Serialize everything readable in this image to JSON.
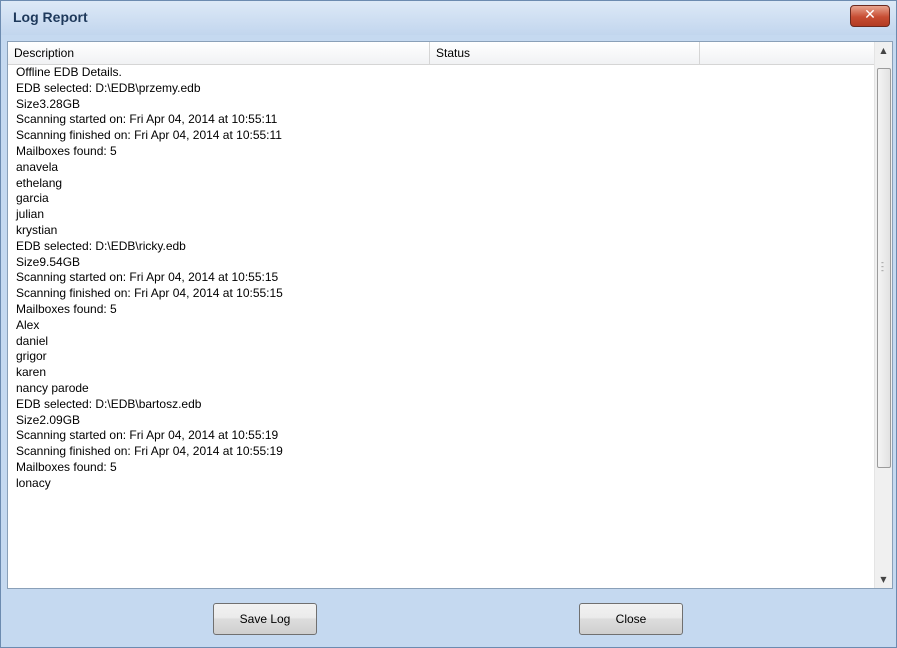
{
  "window": {
    "title": "Log Report",
    "close_glyph": "✕"
  },
  "table": {
    "columns": [
      "Description",
      "Status",
      ""
    ],
    "rows": [
      "Offline EDB Details.",
      "EDB selected: D:\\EDB\\przemy.edb",
      "Size3.28GB",
      "Scanning started on: Fri Apr 04, 2014 at  10:55:11",
      "Scanning finished on: Fri Apr 04, 2014 at  10:55:11",
      "Mailboxes found: 5",
      "anavela",
      "ethelang",
      "garcia",
      "julian",
      "krystian",
      "EDB selected: D:\\EDB\\ricky.edb",
      "Size9.54GB",
      "Scanning started on: Fri Apr 04, 2014 at  10:55:15",
      "Scanning finished on: Fri Apr 04, 2014 at  10:55:15",
      "Mailboxes found: 5",
      "Alex",
      "daniel",
      "grigor",
      "karen",
      "nancy parode",
      "EDB selected: D:\\EDB\\bartosz.edb",
      "Size2.09GB",
      "Scanning started on: Fri Apr 04, 2014 at  10:55:19",
      "Scanning finished on: Fri Apr 04, 2014 at  10:55:19",
      "Mailboxes found: 5",
      "lonacy"
    ]
  },
  "buttons": {
    "save_log": "Save Log",
    "close": "Close"
  }
}
